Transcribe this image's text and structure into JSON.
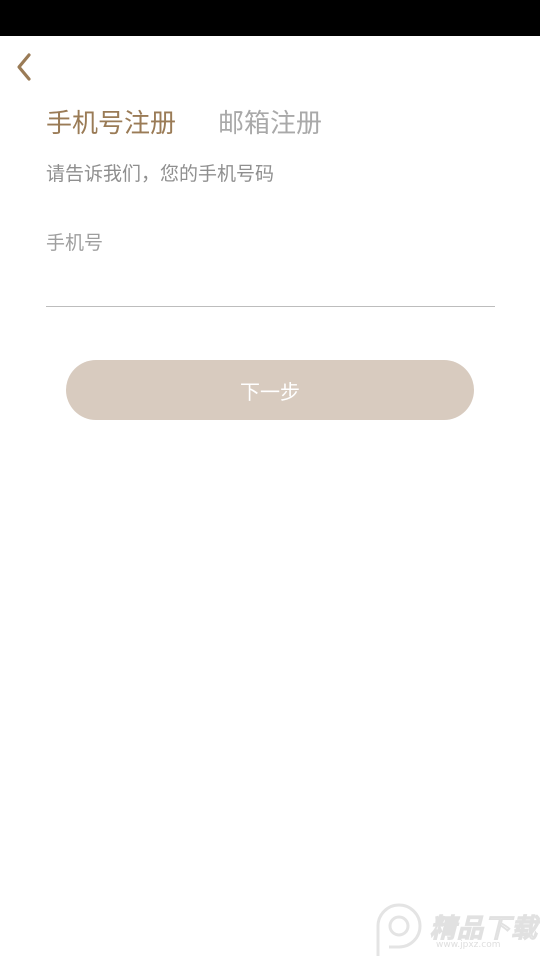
{
  "tabs": {
    "phone_register": "手机号注册",
    "email_register": "邮箱注册"
  },
  "form": {
    "subtitle": "请告诉我们，您的手机号码",
    "phone_label": "手机号",
    "phone_value": "",
    "next_label": "下一步"
  },
  "watermark": {
    "brand": "精品下载",
    "url": "www.jpxz.com"
  },
  "colors": {
    "accent": "#9a7b56",
    "button_bg": "#d8cbbf",
    "inactive_tab": "#a9a9a9",
    "status_bar": "#000000"
  },
  "icons": {
    "back": "chevron-left-icon",
    "watermark": "p-logo-icon"
  }
}
